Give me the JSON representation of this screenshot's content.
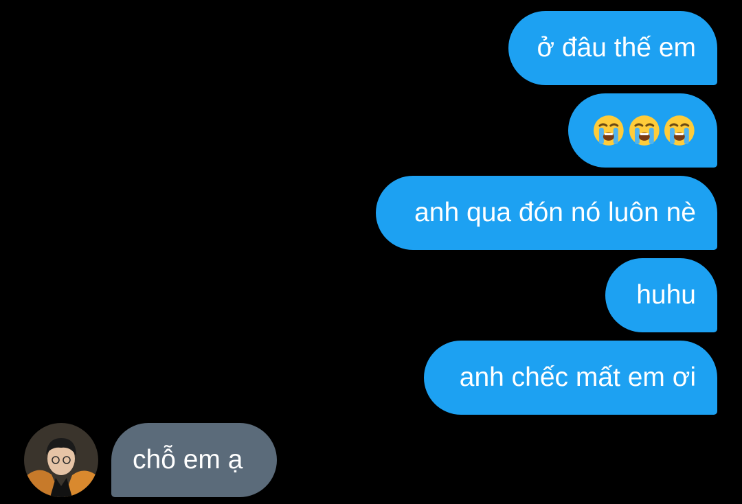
{
  "conversation": {
    "messages": [
      {
        "direction": "sent",
        "text": "ở đâu thế em"
      },
      {
        "direction": "sent",
        "emoji": [
          "loudly-crying-face",
          "loudly-crying-face",
          "loudly-crying-face"
        ]
      },
      {
        "direction": "sent",
        "text": "anh qua đón nó luôn nè"
      },
      {
        "direction": "sent",
        "text": "huhu"
      },
      {
        "direction": "sent",
        "text": "anh chếc mất em ơi"
      },
      {
        "direction": "received",
        "text": "chỗ em ạ",
        "avatar": "contact-avatar"
      }
    ]
  },
  "colors": {
    "background": "#000000",
    "sent_bubble": "#1da1f2",
    "received_bubble": "#5b6b7a",
    "text": "#ffffff"
  }
}
